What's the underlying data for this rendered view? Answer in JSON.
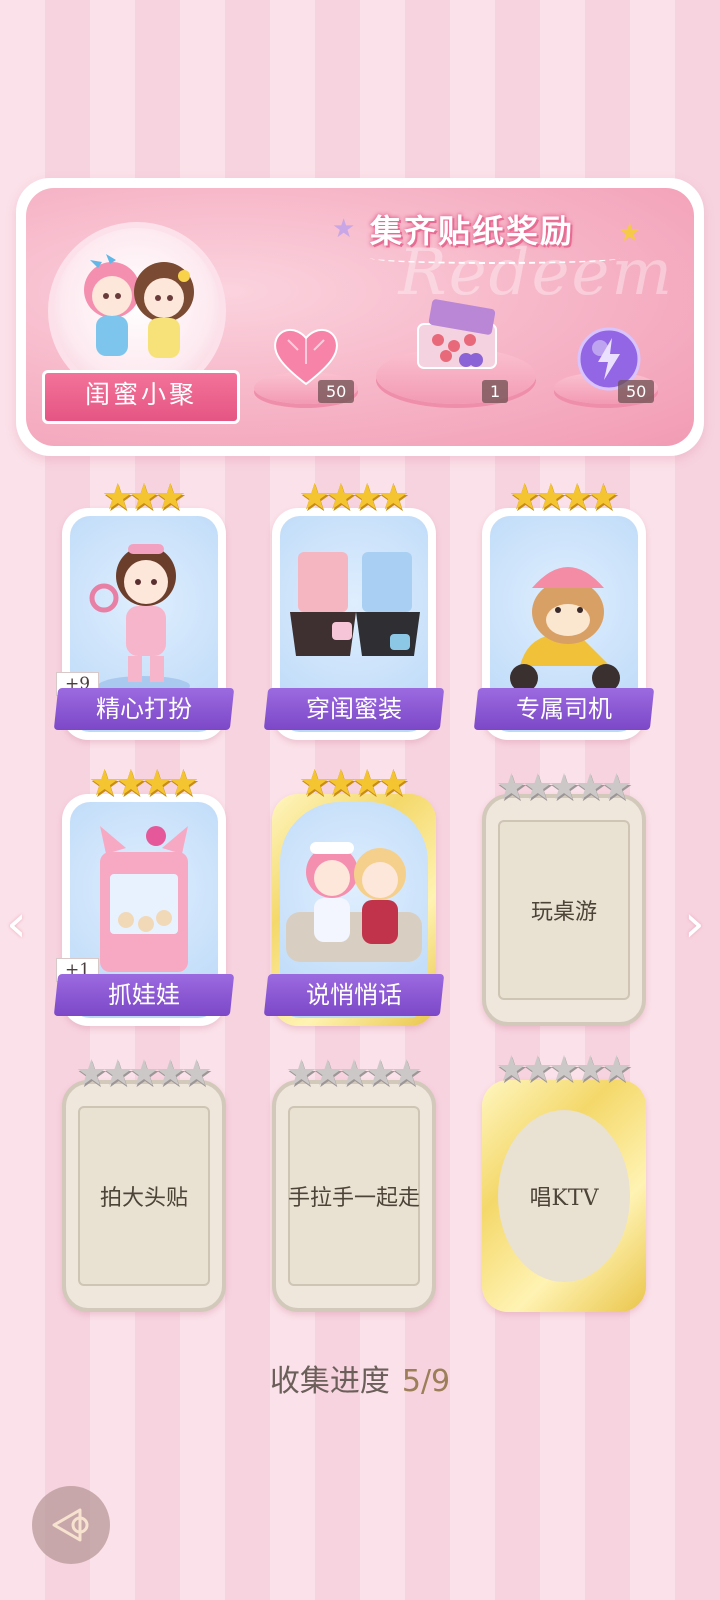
{
  "banner": {
    "title": "集齐贴纸奖励",
    "watermark": "Redeem",
    "portrait_label": "闺蜜小聚",
    "rewards": [
      {
        "icon": "pink-heart-gem-icon",
        "count": "50"
      },
      {
        "icon": "gift-box-icon",
        "count": "1"
      },
      {
        "icon": "purple-energy-orb-icon",
        "count": "50"
      }
    ]
  },
  "cards": [
    {
      "label": "精心打扮",
      "stars": 3,
      "state": "unlocked",
      "bonus": "+9"
    },
    {
      "label": "穿闺蜜装",
      "stars": 4,
      "state": "unlocked"
    },
    {
      "label": "专属司机",
      "stars": 4,
      "state": "unlocked"
    },
    {
      "label": "抓娃娃",
      "stars": 4,
      "state": "unlocked",
      "bonus": "+1"
    },
    {
      "label": "说悄悄话",
      "stars": 4,
      "state": "unlocked",
      "frame": "gold"
    },
    {
      "label": "玩桌游",
      "stars": 5,
      "state": "locked"
    },
    {
      "label": "拍大头贴",
      "stars": 5,
      "state": "locked"
    },
    {
      "label": "手拉手一起走",
      "stars": 5,
      "state": "locked"
    },
    {
      "label": "唱KTV",
      "stars": 5,
      "state": "locked",
      "frame": "gold"
    }
  ],
  "progress": {
    "label": "收集进度",
    "value": "5/9"
  },
  "nav": {
    "prev": "‹",
    "next": "›"
  },
  "colors": {
    "accent_pink": "#e55583",
    "label_purple": "#8a56d4",
    "star_gold": "#f5c531"
  }
}
